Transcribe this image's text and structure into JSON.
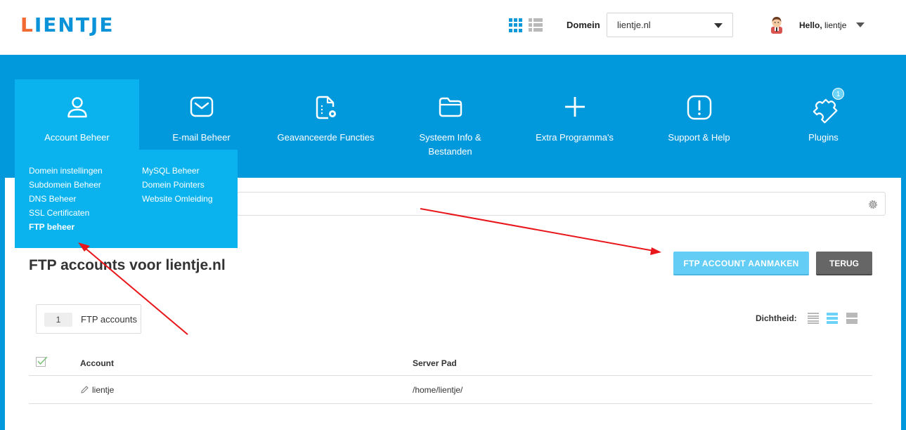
{
  "header": {
    "logo_first": "L",
    "logo_rest": "IENTJE",
    "domain_label": "Domein",
    "domain_value": "lientje.nl",
    "hello_prefix": "Hello,",
    "username": "lientje"
  },
  "nav": {
    "items": [
      {
        "label": "Account Beheer",
        "icon": "user-icon"
      },
      {
        "label": "E-mail Beheer",
        "icon": "envelope-icon"
      },
      {
        "label": "Geavanceerde Functies",
        "icon": "document-gear-icon"
      },
      {
        "label": "Systeem Info & Bestanden",
        "icon": "folder-icon"
      },
      {
        "label": "Extra Programma's",
        "icon": "plus-icon"
      },
      {
        "label": "Support & Help",
        "icon": "exclamation-icon"
      },
      {
        "label": "Plugins",
        "icon": "puzzle-icon"
      }
    ],
    "plugins_badge": "1"
  },
  "dropdown": {
    "left": [
      "Domein instellingen",
      "Subdomein Beheer",
      "DNS Beheer",
      "SSL Certificaten",
      "FTP beheer"
    ],
    "right": [
      "MySQL Beheer",
      "Domein Pointers",
      "Website Omleiding"
    ]
  },
  "page": {
    "title": "FTP accounts voor lientje.nl",
    "create_button": "FTP ACCOUNT AANMAKEN",
    "back_button": "TERUG",
    "count": "1",
    "count_label": "FTP accounts",
    "density_label": "Dichtheid:"
  },
  "table": {
    "columns": [
      "Account",
      "Server Pad"
    ],
    "rows": [
      {
        "account": "lientje",
        "path": "/home/lientje/"
      }
    ]
  },
  "colors": {
    "brand_blue": "#0299dc",
    "menu_blue": "#0ab3ee",
    "logo_orange": "#f06a32",
    "button_light_blue": "#63cdf6",
    "button_gray": "#666666",
    "annotation_red": "#e8161b"
  }
}
